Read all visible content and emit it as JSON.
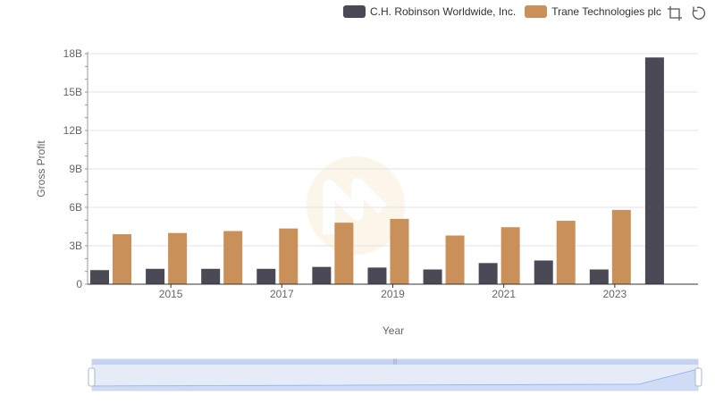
{
  "chart_data": {
    "type": "bar",
    "x": [
      2014,
      2015,
      2016,
      2017,
      2018,
      2019,
      2020,
      2021,
      2022,
      2023,
      2024
    ],
    "xticks": [
      "2015",
      "2017",
      "2019",
      "2021",
      "2023"
    ],
    "series": [
      {
        "name": "C.H. Robinson Worldwide, Inc.",
        "color": "#4a4a56",
        "values": [
          1.1,
          1.2,
          1.2,
          1.2,
          1.35,
          1.3,
          1.15,
          1.65,
          1.85,
          1.15,
          17.7
        ]
      },
      {
        "name": "Trane Technologies plc",
        "color": "#c9905a",
        "values": [
          3.9,
          4.0,
          4.15,
          4.35,
          4.8,
          5.1,
          3.8,
          4.45,
          4.95,
          5.8,
          null
        ]
      }
    ],
    "ylim": [
      0,
      18
    ],
    "yticks": [
      "0",
      "3B",
      "6B",
      "9B",
      "12B",
      "15B",
      "18B"
    ],
    "xlabel": "Year",
    "ylabel": "Gross Profit",
    "legend_position": "top-right",
    "grid": true
  }
}
